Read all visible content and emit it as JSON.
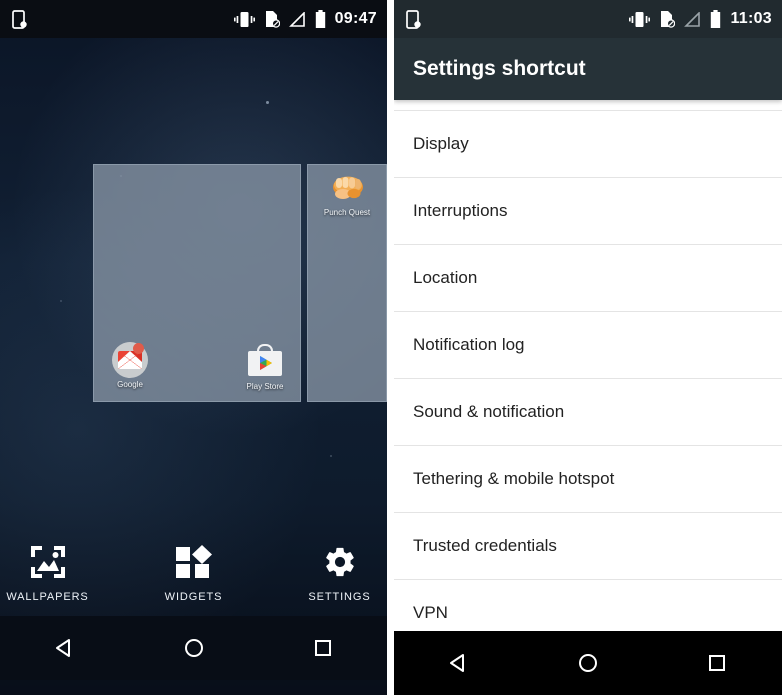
{
  "left_panel": {
    "statusbar": {
      "clock": "09:47",
      "icons": [
        "device-icon",
        "vibrate-icon",
        "no-sim-icon",
        "signal-icon",
        "battery-icon"
      ]
    },
    "home_overview": {
      "pages": [
        {
          "name": "current-page",
          "apps": [
            {
              "label": "Google",
              "icon": "gmail-folder-icon"
            },
            {
              "label": "Play Store",
              "icon": "play-store-icon"
            }
          ]
        },
        {
          "name": "next-page",
          "apps": [
            {
              "label": "Punch Quest",
              "icon": "fist-icon"
            }
          ]
        }
      ]
    },
    "toolbar": [
      {
        "label": "WALLPAPERS",
        "icon": "wallpaper-icon"
      },
      {
        "label": "WIDGETS",
        "icon": "widgets-icon"
      },
      {
        "label": "SETTINGS",
        "icon": "gear-icon"
      }
    ],
    "navbar": [
      {
        "name": "back",
        "icon": "back-triangle-icon"
      },
      {
        "name": "home",
        "icon": "home-circle-icon"
      },
      {
        "name": "recents",
        "icon": "recents-square-icon"
      }
    ]
  },
  "right_panel": {
    "statusbar": {
      "clock": "11:03",
      "icons": [
        "device-icon",
        "vibrate-icon",
        "no-sim-icon",
        "signal-icon",
        "battery-icon"
      ]
    },
    "appbar": {
      "title": "Settings shortcut"
    },
    "list": [
      {
        "label": "Display"
      },
      {
        "label": "Interruptions"
      },
      {
        "label": "Location"
      },
      {
        "label": "Notification log"
      },
      {
        "label": "Sound & notification"
      },
      {
        "label": "Tethering & mobile hotspot"
      },
      {
        "label": "Trusted credentials"
      },
      {
        "label": "VPN"
      }
    ],
    "navbar": [
      {
        "name": "back",
        "icon": "back-triangle-icon"
      },
      {
        "name": "home",
        "icon": "home-circle-icon"
      },
      {
        "name": "recents",
        "icon": "recents-square-icon"
      }
    ]
  },
  "colors": {
    "appbar": "#263238",
    "status_left": "#0a0d13",
    "status_right": "#212a2f",
    "wallpaper": "#0e1b2c",
    "page_card": "#8492a3",
    "list_bg": "#ffffff",
    "divider": "#e4e4e4"
  }
}
